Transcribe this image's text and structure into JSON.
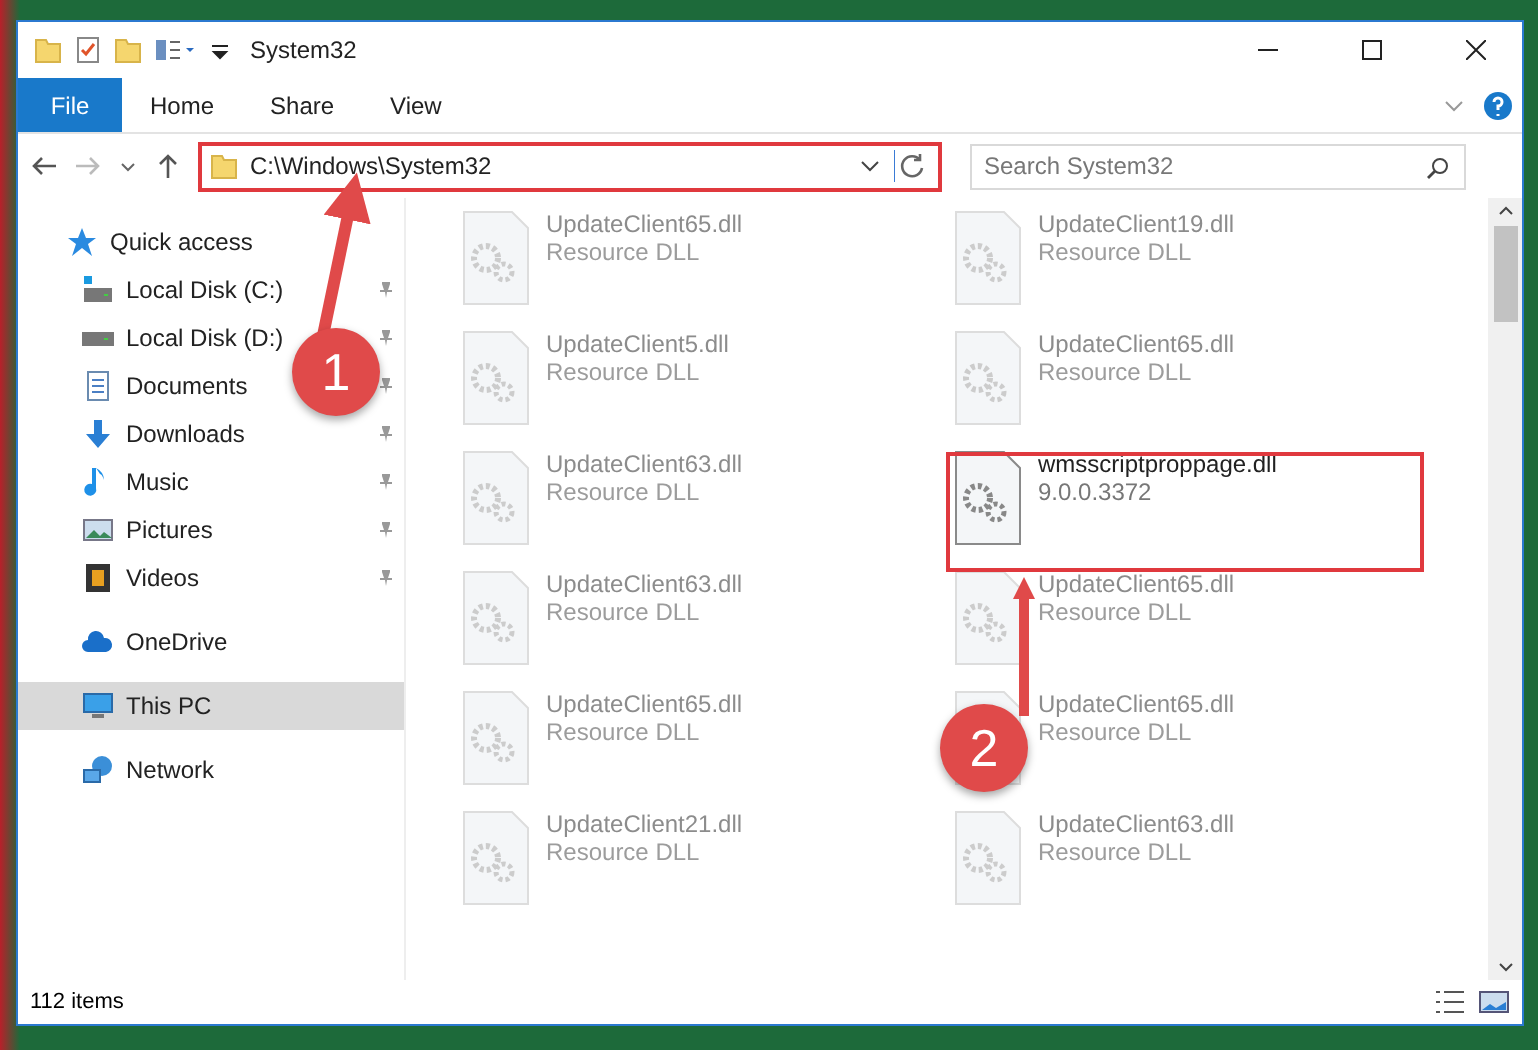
{
  "window": {
    "title": "System32"
  },
  "ribbon_tabs": [
    {
      "label": "File",
      "selected": true
    },
    {
      "label": "Home",
      "selected": false
    },
    {
      "label": "Share",
      "selected": false
    },
    {
      "label": "View",
      "selected": false
    }
  ],
  "address": {
    "path": "C:\\Windows\\System32"
  },
  "search": {
    "placeholder": "Search System32"
  },
  "sidebar": {
    "items": [
      {
        "label": "Quick access",
        "kind": "quick",
        "selected": false,
        "pinned": false
      },
      {
        "label": "Local Disk (C:)",
        "kind": "diskc",
        "selected": false,
        "pinned": true
      },
      {
        "label": "Local Disk (D:)",
        "kind": "disk",
        "selected": false,
        "pinned": true
      },
      {
        "label": "Documents",
        "kind": "docs",
        "selected": false,
        "pinned": true
      },
      {
        "label": "Downloads",
        "kind": "downloads",
        "selected": false,
        "pinned": true
      },
      {
        "label": "Music",
        "kind": "music",
        "selected": false,
        "pinned": true
      },
      {
        "label": "Pictures",
        "kind": "pictures",
        "selected": false,
        "pinned": true
      },
      {
        "label": "Videos",
        "kind": "videos",
        "selected": false,
        "pinned": true
      },
      {
        "label": "OneDrive",
        "kind": "cloud",
        "selected": false,
        "pinned": false
      },
      {
        "label": "This PC",
        "kind": "pc",
        "selected": true,
        "pinned": false
      },
      {
        "label": "Network",
        "kind": "network",
        "selected": false,
        "pinned": false
      }
    ]
  },
  "files": [
    {
      "name": "UpdateClient65.dll",
      "detail": "Resource DLL",
      "highlighted": false
    },
    {
      "name": "UpdateClient19.dll",
      "detail": "Resource DLL",
      "highlighted": false
    },
    {
      "name": "UpdateClient5.dll",
      "detail": "Resource DLL",
      "highlighted": false
    },
    {
      "name": "UpdateClient65.dll",
      "detail": "Resource DLL",
      "highlighted": false
    },
    {
      "name": "UpdateClient63.dll",
      "detail": "Resource DLL",
      "highlighted": false
    },
    {
      "name": "wmsscriptproppage.dll",
      "detail": "9.0.0.3372",
      "highlighted": true
    },
    {
      "name": "UpdateClient63.dll",
      "detail": "Resource DLL",
      "highlighted": false
    },
    {
      "name": "UpdateClient65.dll",
      "detail": "Resource DLL",
      "highlighted": false
    },
    {
      "name": "UpdateClient65.dll",
      "detail": "Resource DLL",
      "highlighted": false
    },
    {
      "name": "UpdateClient65.dll",
      "detail": "Resource DLL",
      "highlighted": false
    },
    {
      "name": "UpdateClient21.dll",
      "detail": "Resource DLL",
      "highlighted": false
    },
    {
      "name": "UpdateClient63.dll",
      "detail": "Resource DLL",
      "highlighted": false
    }
  ],
  "status_bar": {
    "count": "112 items"
  },
  "annotations": [
    {
      "number": "1"
    },
    {
      "number": "2"
    }
  ]
}
